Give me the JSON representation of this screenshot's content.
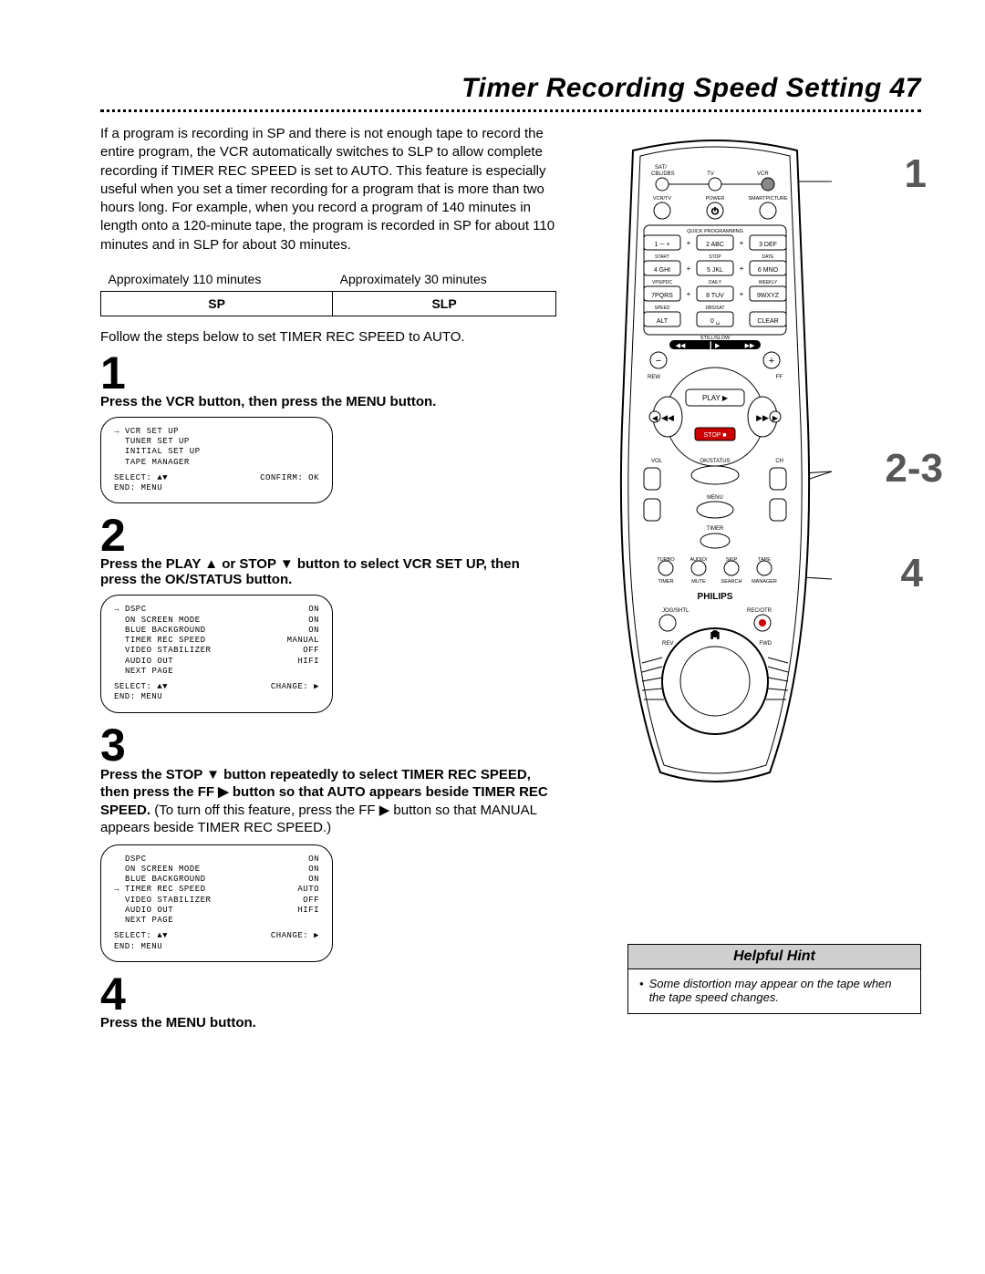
{
  "title": "Timer Recording Speed Setting",
  "page_number": "47",
  "intro": "If a program is recording in SP and there is not enough tape to record the entire program, the VCR automatically switches to SLP to allow complete recording if TIMER REC SPEED is set to AUTO. This feature is especially useful when you set a timer recording for a program that is more than two hours long. For example, when you record a program of 140 minutes in length onto a 120-minute tape, the program is recorded in SP for about 110 minutes and in SLP for about 30 minutes.",
  "speed_table": {
    "headers": [
      "Approximately 110 minutes",
      "Approximately 30 minutes"
    ],
    "cells": [
      "SP",
      "SLP"
    ]
  },
  "follow": "Follow the steps below to set TIMER REC SPEED to AUTO.",
  "steps": {
    "s1": {
      "num": "1",
      "bold": "Press the VCR button, then press the MENU button.",
      "osd": {
        "lines": [
          {
            "arrow": "→",
            "l": "VCR SET UP",
            "r": ""
          },
          {
            "arrow": "",
            "l": "TUNER SET UP",
            "r": ""
          },
          {
            "arrow": "",
            "l": "INITIAL SET UP",
            "r": ""
          },
          {
            "arrow": "",
            "l": "TAPE MANAGER",
            "r": ""
          }
        ],
        "footL": "SELECT: ▲▼",
        "footR": "CONFIRM: OK",
        "end": "END: MENU"
      }
    },
    "s2": {
      "num": "2",
      "bold": "Press the PLAY ▲ or STOP ▼ button to select VCR SET UP, then press the OK/STATUS button.",
      "osd": {
        "lines": [
          {
            "arrow": "→",
            "l": "DSPC",
            "r": "ON"
          },
          {
            "arrow": "",
            "l": "ON SCREEN MODE",
            "r": "ON"
          },
          {
            "arrow": "",
            "l": "BLUE BACKGROUND",
            "r": "ON"
          },
          {
            "arrow": "",
            "l": "TIMER REC SPEED",
            "r": "MANUAL"
          },
          {
            "arrow": "",
            "l": "VIDEO STABILIZER",
            "r": "OFF"
          },
          {
            "arrow": "",
            "l": "AUDIO OUT",
            "r": "HIFI"
          },
          {
            "arrow": "",
            "l": "NEXT PAGE",
            "r": ""
          }
        ],
        "footL": "SELECT: ▲▼",
        "footR": "CHANGE: ▶",
        "end": "END: MENU"
      }
    },
    "s3": {
      "num": "3",
      "bold_a": "Press the STOP ▼ button repeatedly to select TIMER REC SPEED, then press the FF ▶ button so that AUTO appears beside TIMER REC SPEED.",
      "tail": " (To turn off this feature, press the FF ▶ button so that MANUAL appears beside TIMER REC SPEED.)",
      "osd": {
        "lines": [
          {
            "arrow": "",
            "l": "DSPC",
            "r": "ON"
          },
          {
            "arrow": "",
            "l": "ON SCREEN MODE",
            "r": "ON"
          },
          {
            "arrow": "",
            "l": "BLUE BACKGROUND",
            "r": "ON"
          },
          {
            "arrow": "→",
            "l": "TIMER REC SPEED",
            "r": "AUTO"
          },
          {
            "arrow": "",
            "l": "VIDEO STABILIZER",
            "r": "OFF"
          },
          {
            "arrow": "",
            "l": "AUDIO OUT",
            "r": "HIFI"
          },
          {
            "arrow": "",
            "l": "NEXT PAGE",
            "r": ""
          }
        ],
        "footL": "SELECT: ▲▼",
        "footR": "CHANGE: ▶",
        "end": "END: MENU"
      }
    },
    "s4": {
      "num": "4",
      "bold": "Press the MENU button."
    }
  },
  "hint": {
    "title": "Helpful Hint",
    "bullet": "•",
    "text": "Some distortion may appear on the tape when the tape speed changes."
  },
  "callouts": {
    "c1": "1",
    "c23": "2-3",
    "c4": "4"
  },
  "remote": {
    "top_mode": {
      "a": "SAT/",
      "a2": "CBL/DBS",
      "b": "TV",
      "c": "VCR"
    },
    "row2": {
      "a": "VCR/TV",
      "b": "POWER",
      "c": "SMARTPICTURE"
    },
    "quick": "QUICK PROGRAMMING",
    "keys": [
      [
        "1 ─ +",
        "2 ABC",
        "3 DEF"
      ],
      [
        "4 GHI",
        "5 JKL",
        "6 MNO"
      ],
      [
        "7PQRS",
        "8 TUV",
        "9WXYZ"
      ],
      [
        "ALT",
        "0 ␣",
        "CLEAR"
      ]
    ],
    "krow_labels": [
      [
        "START",
        "STOP",
        "DATE"
      ],
      [
        "VPS/PDC",
        "DAILY",
        "WEEKLY"
      ],
      [
        "SPEED",
        "DBS/SAT",
        ""
      ]
    ],
    "still": "STILL/SLOW",
    "rew": "REW",
    "ff": "FF",
    "play": "PLAY ▶",
    "stop": "STOP ■",
    "vol": "VOL",
    "ch": "CH",
    "okstatus": "OK/STATUS",
    "menu": "MENU",
    "timer": "TIMER",
    "bottom_row": {
      "a": "TURBO",
      "b": "AUDIO/",
      "c": "SKIP",
      "d": "TAPE"
    },
    "bottom_row2": {
      "a": "TIMER",
      "b": "MUTE",
      "c": "SEARCH",
      "d": "MANAGER"
    },
    "brand": "PHILIPS",
    "jog": "JOG/SHTL",
    "rec": "REC/OTR",
    "rev": "REV",
    "fwd": "FWD",
    "pause": "❚❚"
  }
}
